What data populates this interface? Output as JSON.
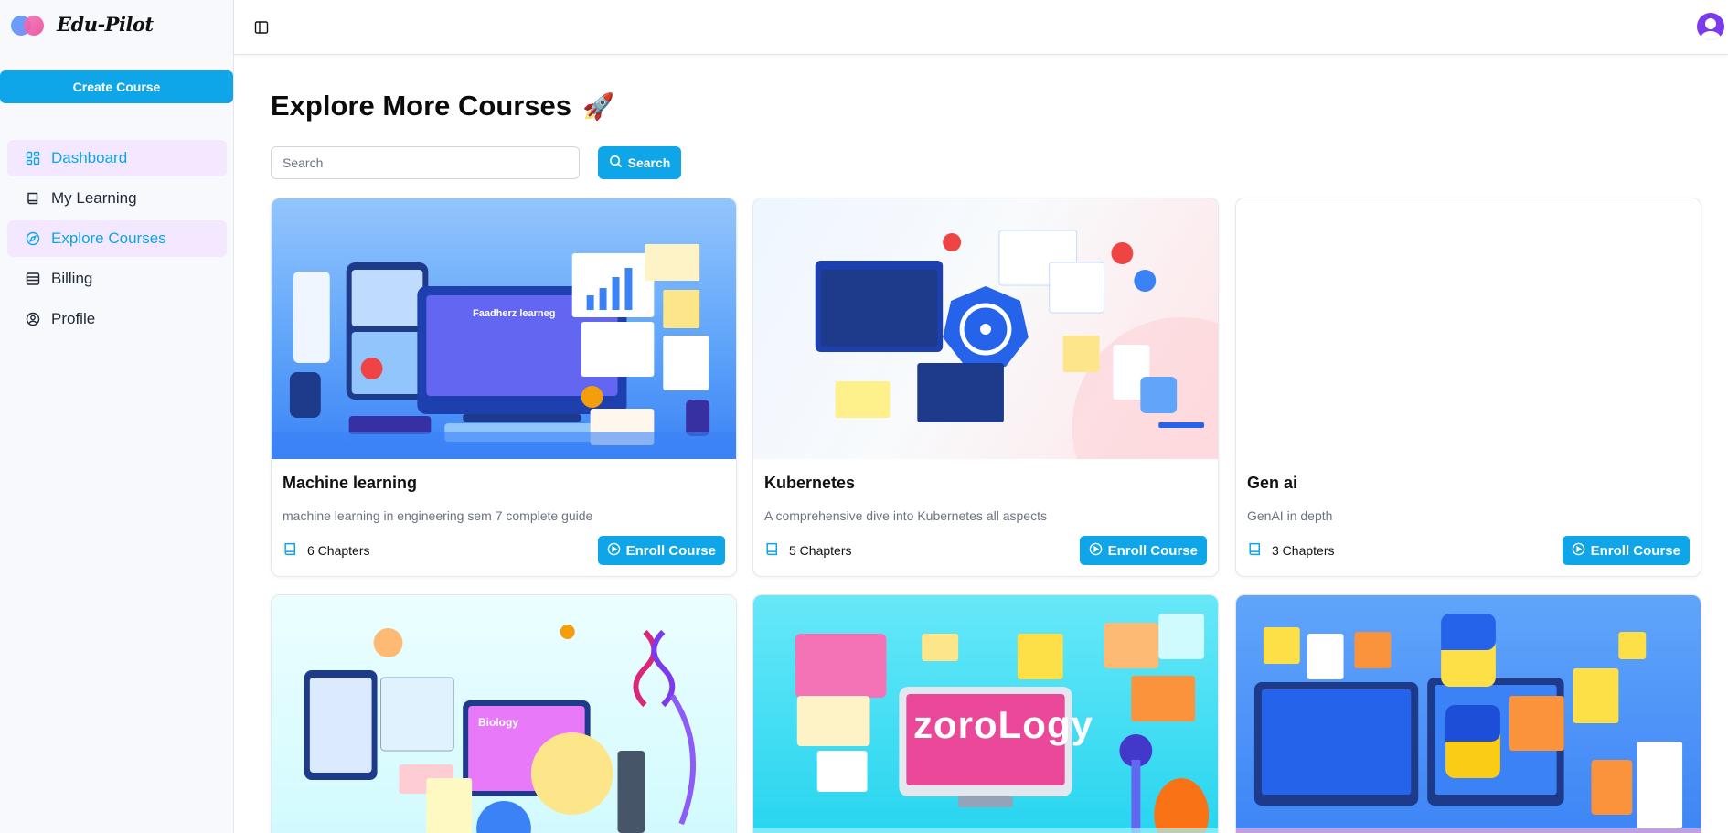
{
  "app": {
    "name": "Edu-Pilot"
  },
  "sidebar": {
    "create_label": "Create Course",
    "items": [
      {
        "label": "Dashboard",
        "icon": "layout-grid-icon",
        "active": true
      },
      {
        "label": "My Learning",
        "icon": "book-icon",
        "active": false
      },
      {
        "label": "Explore Courses",
        "icon": "compass-icon",
        "active": true
      },
      {
        "label": "Billing",
        "icon": "archive-icon",
        "active": false
      },
      {
        "label": "Profile",
        "icon": "user-circle-icon",
        "active": false
      }
    ]
  },
  "header": {
    "sidebar_toggle_icon": "panel-left-icon",
    "avatar_icon": "user-avatar-icon"
  },
  "main": {
    "title": "Explore More Courses",
    "title_emoji": "🚀",
    "search": {
      "placeholder": "Search",
      "value": "",
      "button_label": "Search"
    },
    "enroll_label": "Enroll Course",
    "courses": [
      {
        "title": "Machine learning",
        "description": "machine learning in engineering sem 7 complete guide",
        "chapters": "6 Chapters",
        "banner_text": "Faadherz learneg"
      },
      {
        "title": "Kubernetes",
        "description": "A comprehensive dive into Kubernetes all aspects",
        "chapters": "5 Chapters",
        "banner_text": ""
      },
      {
        "title": "Gen ai",
        "description": "GenAI in depth",
        "chapters": "3 Chapters",
        "banner_text": ""
      },
      {
        "title": "",
        "description": "",
        "chapters": "",
        "banner_text": "Biology"
      },
      {
        "title": "",
        "description": "",
        "chapters": "",
        "banner_text": "zoroLogy"
      },
      {
        "title": "",
        "description": "",
        "chapters": "",
        "banner_text": ""
      }
    ]
  },
  "colors": {
    "accent": "#0ea5e9",
    "active_bg": "#f3e8ff",
    "avatar": "#7c3aed"
  }
}
